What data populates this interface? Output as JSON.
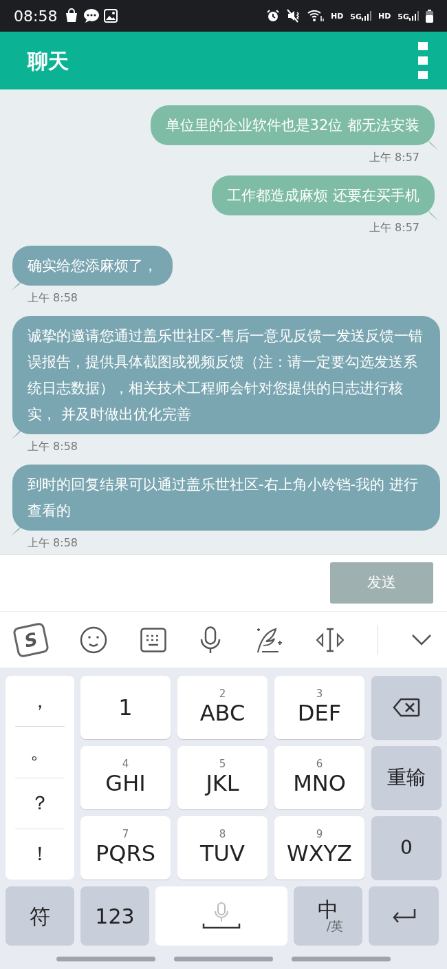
{
  "status_bar": {
    "time": "08:58",
    "network_labels": [
      "HD",
      "5G",
      "HD",
      "5G"
    ]
  },
  "header": {
    "title": "聊天"
  },
  "messages": [
    {
      "kind": "outgoing",
      "text": "单位里的企业软件也是32位 都无法安装",
      "time": "上午 8:57"
    },
    {
      "kind": "outgoing",
      "text": "工作都造成麻烦 还要在买手机",
      "time": "上午 8:57"
    },
    {
      "kind": "incoming",
      "text": "确实给您添麻烦了，",
      "time": "上午 8:58"
    },
    {
      "kind": "incoming",
      "text": "诚挚的邀请您通过盖乐世社区-售后一意见反馈一发送反馈一错误报告，提供具体截图或视频反馈（注：请一定要勾选发送系统日志数据），相关技术工程师会针对您提供的日志进行核实， 并及时做出优化完善",
      "time": "上午 8:58"
    },
    {
      "kind": "incoming",
      "text": "到时的回复结果可以通过盖乐世社区-右上角小铃铛-我的 进行查看的",
      "time": "上午 8:58"
    }
  ],
  "composer": {
    "send_label": "发送",
    "disabled": true
  },
  "ime_toolbar": {
    "logo": "S"
  },
  "keyboard": {
    "punctuation": [
      "，",
      "。",
      "？",
      "！"
    ],
    "keys": [
      {
        "kind": "letter",
        "letters": "1"
      },
      {
        "kind": "letter",
        "digit": "2",
        "letters": "ABC"
      },
      {
        "kind": "letter",
        "digit": "3",
        "letters": "DEF"
      },
      {
        "kind": "backspace"
      },
      {
        "kind": "letter",
        "digit": "4",
        "letters": "GHI"
      },
      {
        "kind": "letter",
        "digit": "5",
        "letters": "JKL"
      },
      {
        "kind": "letter",
        "digit": "6",
        "letters": "MNO"
      },
      {
        "kind": "func",
        "letters": "重输"
      },
      {
        "kind": "letter",
        "digit": "7",
        "letters": "PQRS"
      },
      {
        "kind": "letter",
        "digit": "8",
        "letters": "TUV"
      },
      {
        "kind": "letter",
        "digit": "9",
        "letters": "WXYZ"
      },
      {
        "kind": "func",
        "letters": "0"
      }
    ],
    "bottom_row": [
      {
        "kind": "func",
        "label": "符"
      },
      {
        "kind": "func",
        "label": "123"
      },
      {
        "kind": "space"
      },
      {
        "kind": "lang",
        "label": "中",
        "sub": "/英"
      },
      {
        "kind": "enter"
      }
    ]
  }
}
